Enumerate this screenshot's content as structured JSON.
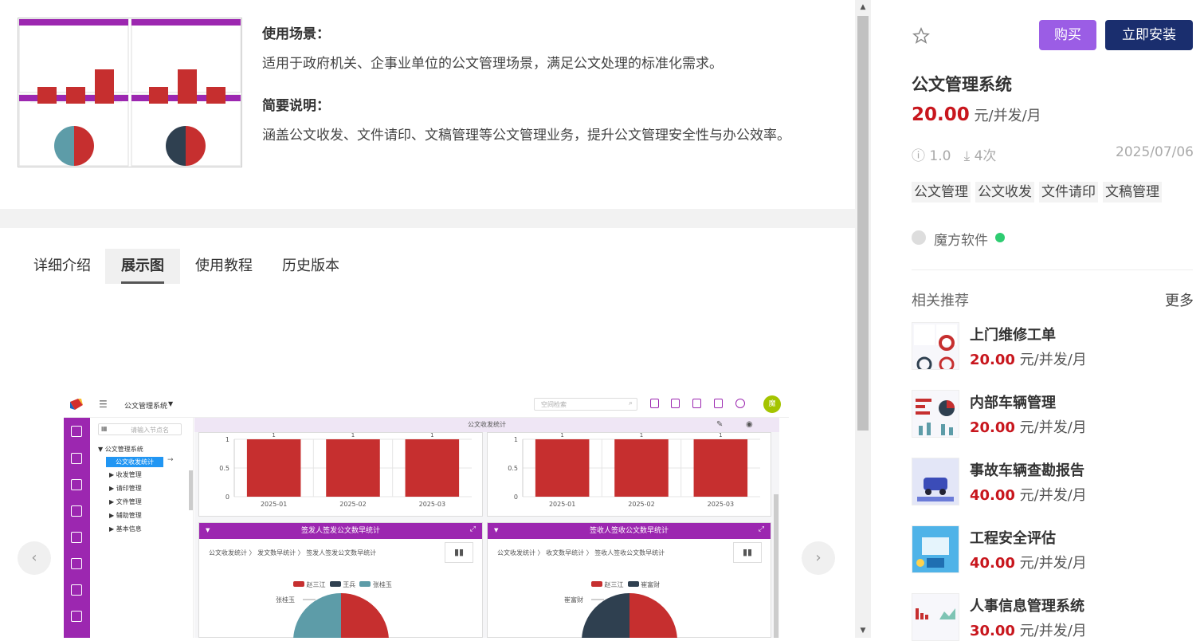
{
  "intro": {
    "scene_title": "使用场景：",
    "scene_text": "适用于政府机关、企事业单位的公文管理场景，满足公文处理的标准化需求。",
    "brief_title": "简要说明：",
    "brief_text": "涵盖公文收发、文件请印、文稿管理等公文管理业务，提升公文管理安全性与办公效率。"
  },
  "tabs": [
    {
      "label": "详细介绍",
      "active": false
    },
    {
      "label": "展示图",
      "active": true
    },
    {
      "label": "使用教程",
      "active": false
    },
    {
      "label": "历史版本",
      "active": false
    }
  ],
  "carousel": {
    "prev_icon": "chevron-left-icon",
    "next_icon": "chevron-right-icon"
  },
  "app": {
    "title": "公文管理系统",
    "search_placeholder": "空间检索",
    "avatar": "魔",
    "tree_search_placeholder": "请输入节点名",
    "tree_root": "公文管理系统",
    "tree_items": [
      "公文收发统计",
      "收发管理",
      "请印管理",
      "文件管理",
      "辅助管理",
      "基本信息"
    ],
    "section_header": "公文收发统计",
    "chart_left": {
      "categories": [
        "2025-01",
        "2025-02",
        "2025-03"
      ],
      "values": [
        1,
        1,
        1
      ],
      "yticks": [
        "1",
        "0.5",
        "0"
      ]
    },
    "chart_right": {
      "categories": [
        "2025-01",
        "2025-02",
        "2025-03"
      ],
      "values": [
        1,
        1,
        1
      ],
      "yticks": [
        "1",
        "0.5",
        "0"
      ]
    },
    "panel_left": {
      "title": "签发人签发公文数早统计",
      "breadcrumb": [
        "公文收发统计",
        "发文数早统计",
        "签发人签发公文数早统计"
      ],
      "legend": [
        "赵三江",
        "王兵",
        "张桂玉"
      ],
      "label_left": "张桂玉"
    },
    "panel_right": {
      "title": "签收人签收公文数早统计",
      "breadcrumb": [
        "公文收发统计",
        "收文数早统计",
        "签收人签收公文数早统计"
      ],
      "legend": [
        "赵三江",
        "崔富财"
      ],
      "label_left": "崔富财"
    }
  },
  "product": {
    "buy_label": "购买",
    "install_label": "立即安装",
    "name": "公文管理系统",
    "price": "20.00",
    "price_unit": "元/并发/月",
    "version": "1.0",
    "downloads": "4次",
    "date": "2025/07/06",
    "tags": [
      "公文管理",
      "公文收发",
      "文件请印",
      "文稿管理"
    ],
    "vendor": "魔方软件"
  },
  "recommend": {
    "title": "相关推荐",
    "more": "更多",
    "items": [
      {
        "name": "上门维修工单",
        "price": "20.00",
        "unit": "元/并发/月"
      },
      {
        "name": "内部车辆管理",
        "price": "20.00",
        "unit": "元/并发/月"
      },
      {
        "name": "事故车辆查勘报告",
        "price": "40.00",
        "unit": "元/并发/月"
      },
      {
        "name": "工程安全评估",
        "price": "40.00",
        "unit": "元/并发/月"
      },
      {
        "name": "人事信息管理系统",
        "price": "30.00",
        "unit": "元/并发/月"
      }
    ]
  },
  "colors": {
    "purple": "#9c27b0",
    "bar_red": "#c62f2f",
    "price_red": "#c8161d",
    "install_navy": "#1a2e6e",
    "buy_violet": "#9b5de5"
  }
}
